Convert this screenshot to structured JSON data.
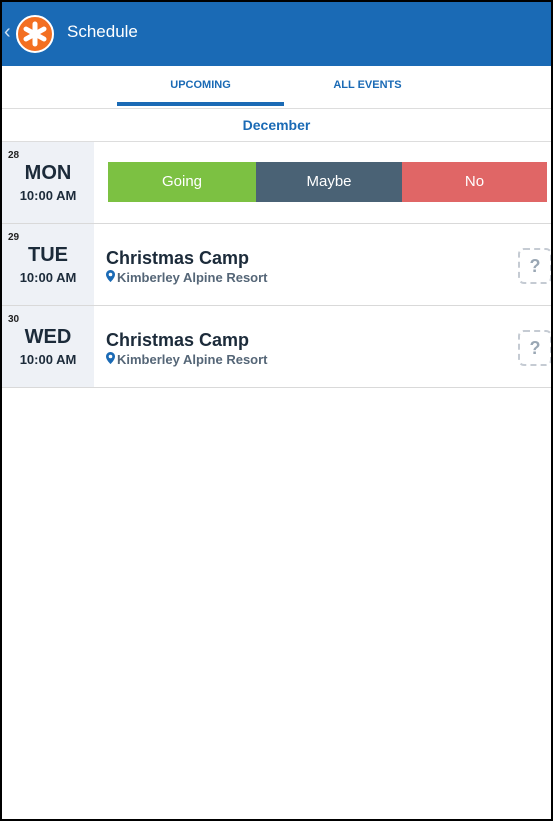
{
  "appbar": {
    "back_glyph": "‹",
    "logo_icon": "asterisk-logo-icon",
    "title": "Schedule"
  },
  "tabs": [
    {
      "label": "UPCOMING",
      "active": true
    },
    {
      "label": "ALL EVENTS",
      "active": false
    }
  ],
  "month": "December",
  "rows": [
    {
      "day_num": "28",
      "day_name": "MON",
      "time": "10:00 AM",
      "rsvp": {
        "going": "Going",
        "maybe": "Maybe",
        "no": "No"
      }
    },
    {
      "day_num": "29",
      "day_name": "TUE",
      "time": "10:00 AM",
      "title": "Christmas Camp",
      "location": "Kimberley Alpine Resort",
      "status_glyph": "?"
    },
    {
      "day_num": "30",
      "day_name": "WED",
      "time": "10:00 AM",
      "title": "Christmas Camp",
      "location": "Kimberley Alpine Resort",
      "status_glyph": "?"
    }
  ],
  "colors": {
    "primary": "#1a6ab5",
    "accent_logo": "#f36f21",
    "going": "#7cc142",
    "maybe": "#4a6275",
    "no": "#e06666"
  }
}
